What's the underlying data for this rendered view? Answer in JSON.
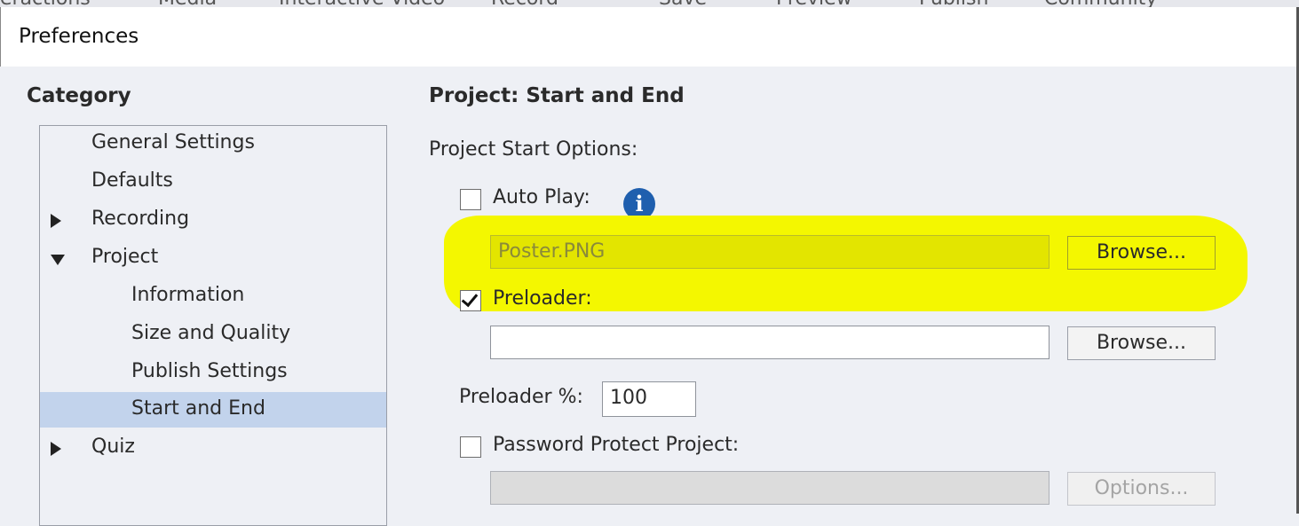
{
  "background_menu": [
    "eractions",
    "Media",
    "Interactive Video",
    "Record",
    "Save",
    "Preview",
    "Publish",
    "Community"
  ],
  "dialog": {
    "title": "Preferences"
  },
  "category": {
    "heading": "Category",
    "items": [
      {
        "label": "General Settings",
        "expander": "none"
      },
      {
        "label": "Defaults",
        "expander": "none"
      },
      {
        "label": "Recording",
        "expander": "collapsed"
      },
      {
        "label": "Project",
        "expander": "expanded"
      },
      {
        "label": "Information",
        "expander": "none"
      },
      {
        "label": "Size and Quality",
        "expander": "none"
      },
      {
        "label": "Publish Settings",
        "expander": "none"
      },
      {
        "label": "Start and End",
        "expander": "none",
        "selected": true
      },
      {
        "label": "Quiz",
        "expander": "collapsed"
      }
    ]
  },
  "panel": {
    "heading": "Project: Start and End",
    "section_label": "Project Start Options:",
    "auto_play": {
      "label": "Auto Play:",
      "checked": false,
      "icon": "info-icon",
      "icon_glyph": "i"
    },
    "poster": {
      "value": "Poster.PNG",
      "browse_label": "Browse...",
      "highlight_color": "#f4f700"
    },
    "preloader": {
      "label": "Preloader:",
      "checked": true,
      "value": "",
      "browse_label": "Browse..."
    },
    "preloader_percent": {
      "label": "Preloader %:",
      "value": "100"
    },
    "password": {
      "label": "Password Protect Project:",
      "checked": false,
      "value": "",
      "options_label": "Options..."
    }
  },
  "colors": {
    "selection": "#c2d3ec",
    "info_icon": "#1f5fae"
  }
}
